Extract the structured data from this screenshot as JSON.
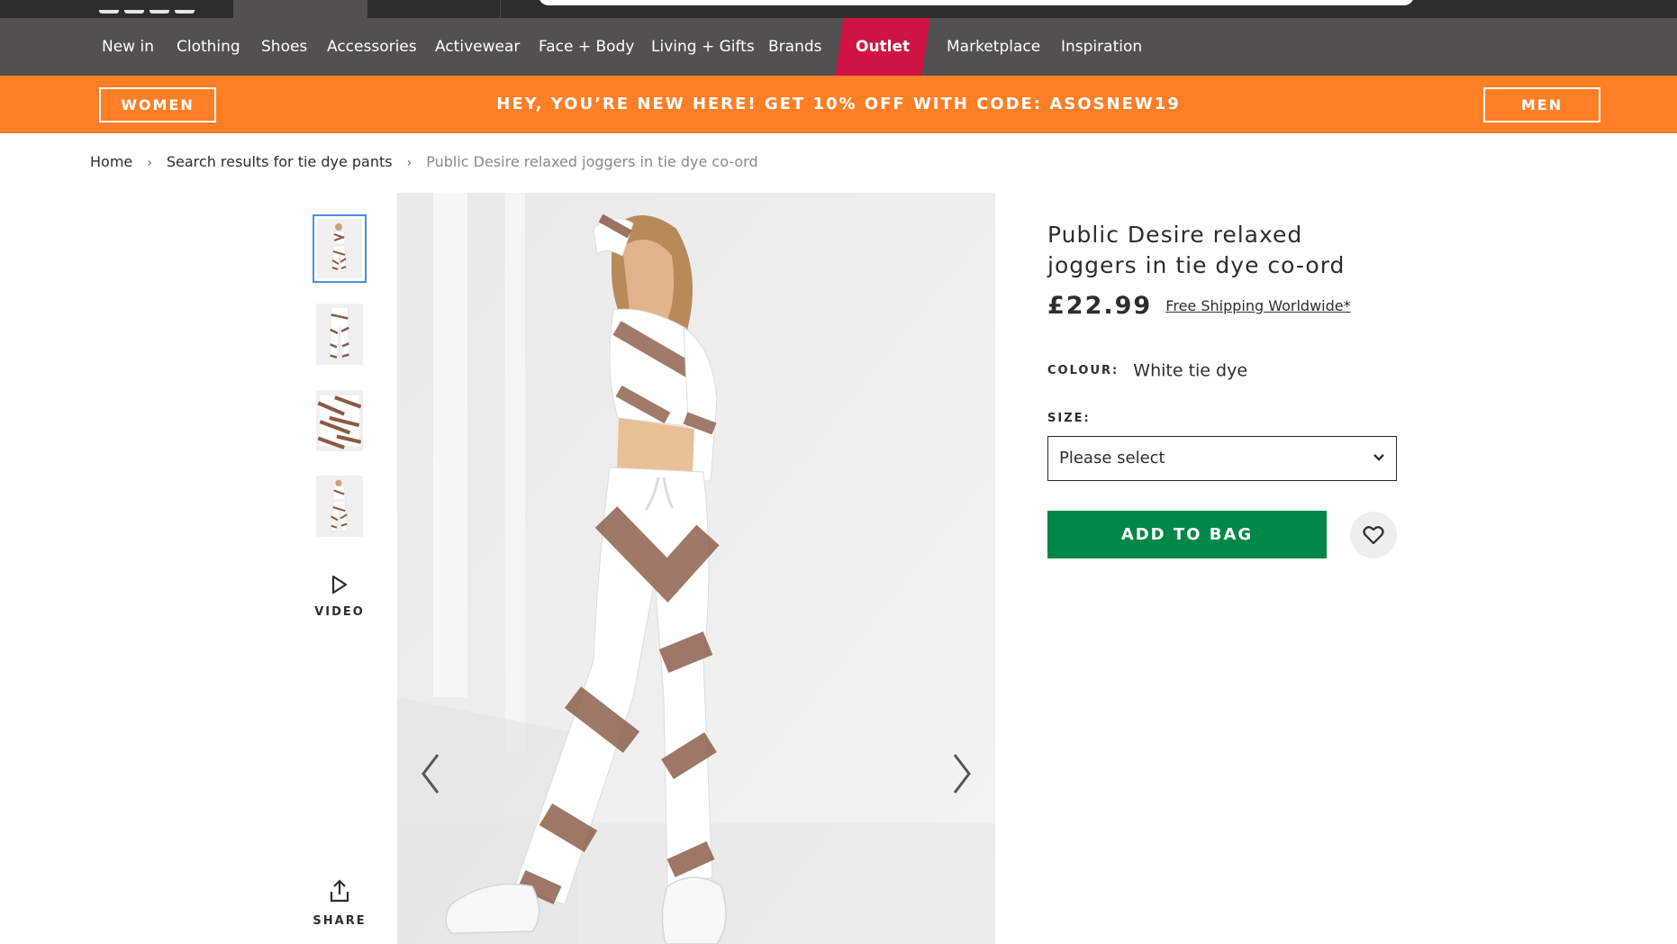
{
  "nav": {
    "items": [
      "New in",
      "Clothing",
      "Shoes",
      "Accessories",
      "Activewear",
      "Face + Body",
      "Living + Gifts",
      "Brands",
      "Outlet",
      "Marketplace",
      "Inspiration"
    ]
  },
  "promo": {
    "women_label": "WOMEN",
    "men_label": "MEN",
    "text": "HEY, YOU’RE NEW HERE! GET 10% OFF WITH CODE: ASOSNEW19",
    "color": "#ff7f27"
  },
  "breadcrumb": {
    "home": "Home",
    "search": "Search results for tie dye pants",
    "current": "Public Desire relaxed joggers in tie dye co-ord"
  },
  "gallery": {
    "thumbnails_count": 4,
    "selected_index": 0,
    "video_label": "VIDEO",
    "share_label": "SHARE"
  },
  "product": {
    "title": "Public Desire relaxed joggers in tie dye co-ord",
    "price": "£22.99",
    "shipping": "Free Shipping Worldwide*",
    "colour_label": "COLOUR:",
    "colour_value": "White tie dye",
    "size_label": "SIZE:",
    "size_placeholder": "Please select",
    "add_to_bag": "ADD TO BAG"
  },
  "colors": {
    "nav_bg": "#525050",
    "outlet_bg": "#d01345",
    "add_btn": "#018849",
    "selected_thumb_border": "#4a90e2"
  },
  "icons": [
    "play-icon",
    "share-icon",
    "chevron-left-icon",
    "chevron-right-icon",
    "chevron-down-icon",
    "heart-icon"
  ]
}
